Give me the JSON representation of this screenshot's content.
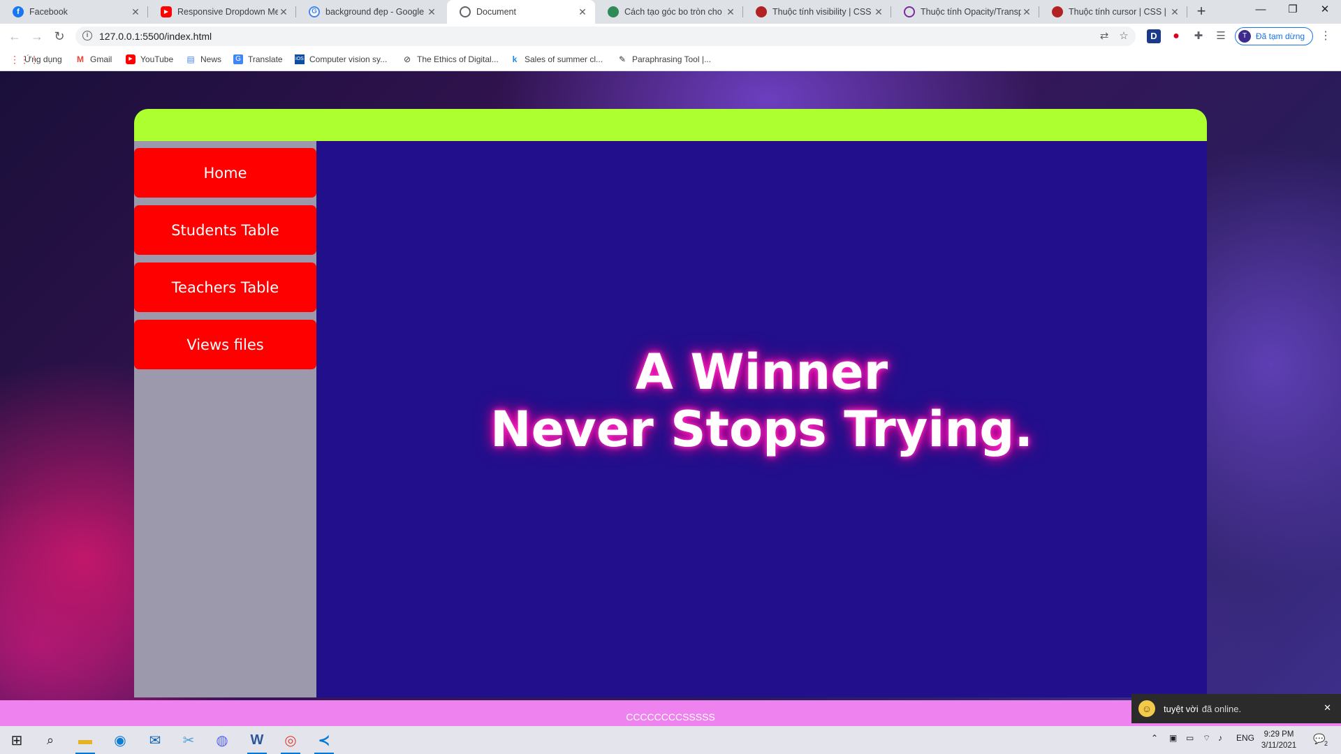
{
  "browser": {
    "tabs": [
      {
        "title": "Facebook",
        "favicon": "facebook-icon",
        "color": "#1877f2",
        "active": false
      },
      {
        "title": "Responsive Dropdown Men",
        "favicon": "youtube-icon",
        "color": "#ff0000",
        "active": false
      },
      {
        "title": "background đẹp - Google T",
        "favicon": "google-icon",
        "color": "#4285f4",
        "active": false
      },
      {
        "title": "Document",
        "favicon": "globe-icon",
        "color": "#5f6368",
        "active": true
      },
      {
        "title": "Cách tạo góc bo tròn cho p",
        "favicon": "site-icon",
        "color": "#2e8b57",
        "active": false
      },
      {
        "title": "Thuộc tính visibility | CSS | H",
        "favicon": "site-icon",
        "color": "#b22222",
        "active": false
      },
      {
        "title": "Thuộc tính Opacity/Transpa",
        "favicon": "site-icon",
        "color": "#7b2aa0",
        "active": false
      },
      {
        "title": "Thuộc tính cursor | CSS | Ho",
        "favicon": "site-icon",
        "color": "#b22222",
        "active": false
      }
    ],
    "new_tab_label": "+",
    "url": "127.0.0.1:5500/index.html",
    "profile_initial": "T",
    "profile_label": "Đã tạm dừng",
    "bookmarks": [
      {
        "label": "Ứng dụng",
        "icon": "apps-grid-icon",
        "color": "#4285f4"
      },
      {
        "label": "Gmail",
        "icon": "gmail-icon",
        "color": "#ea4335"
      },
      {
        "label": "YouTube",
        "icon": "youtube-icon",
        "color": "#ff0000"
      },
      {
        "label": "News",
        "icon": "news-icon",
        "color": "#4285f4"
      },
      {
        "label": "Translate",
        "icon": "translate-icon",
        "color": "#4285f4"
      },
      {
        "label": "Computer vision sy...",
        "icon": "ios-icon",
        "color": "#0b4ea2"
      },
      {
        "label": "The Ethics of Digital...",
        "icon": "bookmark-icon",
        "color": "#333333"
      },
      {
        "label": "Sales of summer cl...",
        "icon": "k-icon",
        "color": "#1e88e5"
      },
      {
        "label": "Paraphrasing Tool |...",
        "icon": "pen-icon",
        "color": "#333333"
      }
    ]
  },
  "page": {
    "nav": [
      "Home",
      "Students Table",
      "Teachers Table",
      "Views files"
    ],
    "quote_line1": "A Winner",
    "quote_line2": "Never Stops Trying.",
    "footer_text": "CCCCCCCCSSSSS",
    "colors": {
      "header": "#adff2f",
      "sidebar": "#9b99ab",
      "nav_button": "#ff0000",
      "main": "#220f8c",
      "footer": "#ee82ee",
      "glow": "#ff00aa"
    }
  },
  "notification": {
    "user": "tuyệt vời",
    "message": "đã online."
  },
  "taskbar": {
    "apps": [
      "windows-start-icon",
      "search-icon",
      "file-explorer-icon",
      "edge-icon",
      "mail-icon",
      "snipping-icon",
      "discord-icon",
      "word-icon",
      "chrome-icon",
      "vscode-icon"
    ],
    "language": "ENG",
    "time": "9:29 PM",
    "date": "3/11/2021",
    "notification_count": "2"
  }
}
